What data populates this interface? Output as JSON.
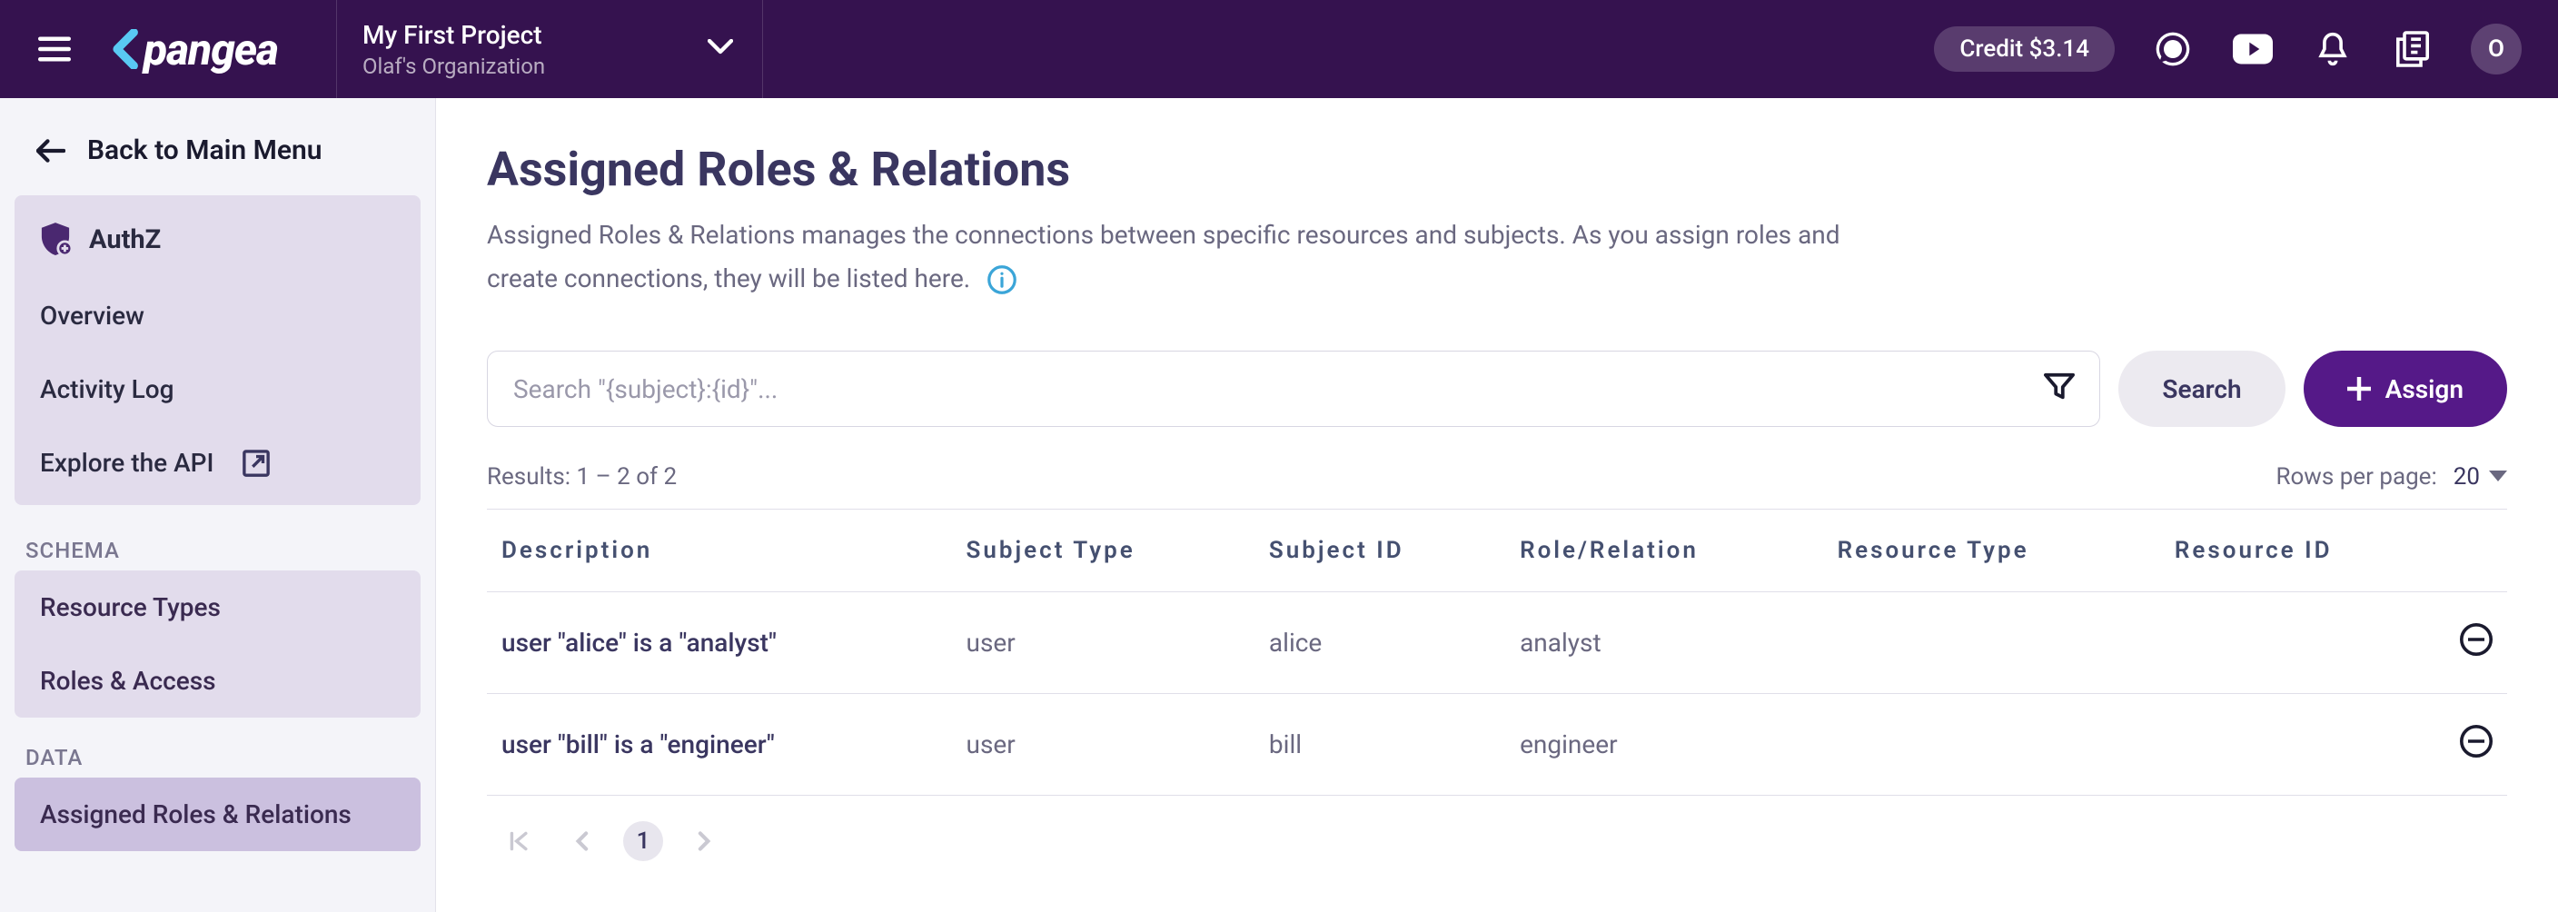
{
  "topbar": {
    "project_title": "My First Project",
    "org_name": "Olaf's Organization",
    "credit_label": "Credit $3.14",
    "avatar_initial": "O"
  },
  "sidebar": {
    "back_label": "Back to Main Menu",
    "service_label": "AuthZ",
    "items": [
      {
        "label": "Overview"
      },
      {
        "label": "Activity Log"
      },
      {
        "label": "Explore the API"
      }
    ],
    "section_schema": "SCHEMA",
    "schema_items": [
      {
        "label": "Resource Types"
      },
      {
        "label": "Roles & Access"
      }
    ],
    "section_data": "DATA",
    "data_items": [
      {
        "label": "Assigned Roles & Relations",
        "active": true
      }
    ]
  },
  "main": {
    "title": "Assigned Roles & Relations",
    "description": "Assigned Roles & Relations manages the connections between specific resources and subjects. As you assign roles and create connections, they will be listed here.",
    "search_placeholder": "Search \"{subject}:{id}\"...",
    "search_button": "Search",
    "assign_button": "Assign",
    "results_text": "Results: 1 – 2 of 2",
    "rows_per_page_label": "Rows per page:",
    "rows_per_page_value": "20",
    "columns": [
      "Description",
      "Subject Type",
      "Subject ID",
      "Role/Relation",
      "Resource Type",
      "Resource ID"
    ],
    "rows": [
      {
        "description": "user \"alice\" is a \"analyst\"",
        "subject_type": "user",
        "subject_id": "alice",
        "role": "analyst",
        "resource_type": "",
        "resource_id": ""
      },
      {
        "description": "user \"bill\" is a \"engineer\"",
        "subject_type": "user",
        "subject_id": "bill",
        "role": "engineer",
        "resource_type": "",
        "resource_id": ""
      }
    ],
    "current_page": "1"
  }
}
